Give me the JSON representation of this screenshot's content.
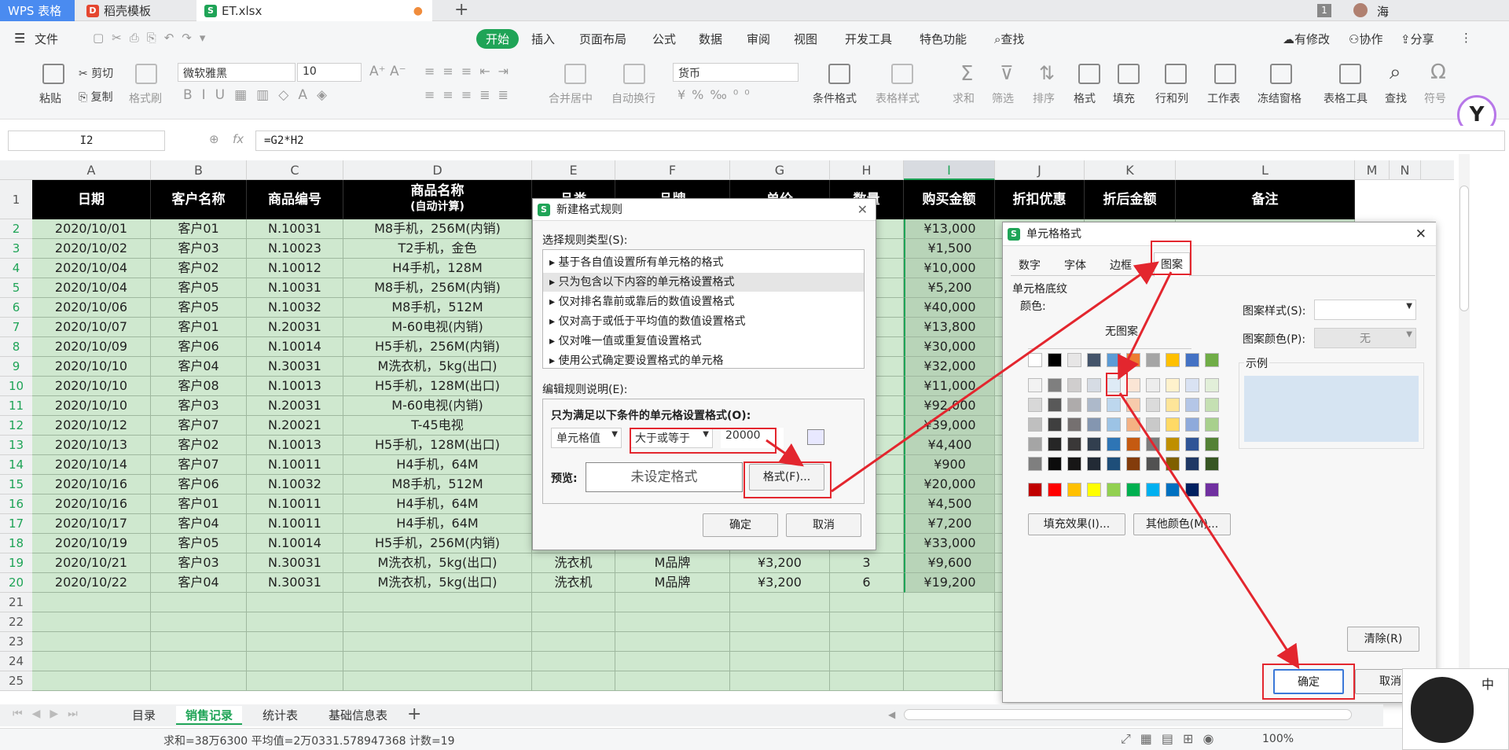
{
  "tabs": {
    "wps": "WPS 表格",
    "daoke": "稻壳模板",
    "file": "ET.xlsx",
    "user": "海",
    "page_count": "1"
  },
  "menu": {
    "file": "文件",
    "items": [
      "开始",
      "插入",
      "页面布局",
      "公式",
      "数据",
      "审阅",
      "视图",
      "开发工具",
      "特色功能"
    ],
    "search": "查找",
    "modified": "有修改",
    "collab": "协作",
    "share": "分享"
  },
  "ribbon": {
    "paste": "粘贴",
    "cut": "剪切",
    "copy": "复制",
    "format_painter": "格式刷",
    "font": "微软雅黑",
    "size": "10",
    "number_format": "货币",
    "merge": "合并居中",
    "wrap": "自动换行",
    "cond_format": "条件格式",
    "table_style": "表格样式",
    "sum": "求和",
    "filter": "筛选",
    "sort": "排序",
    "format": "格式",
    "fill": "填充",
    "rowcol": "行和列",
    "worksheet": "工作表",
    "freeze": "冻结窗格",
    "table_tools": "表格工具",
    "find": "查找",
    "symbol": "符号"
  },
  "formula": {
    "cell": "I2",
    "fx": "fx",
    "value": "=G2*H2"
  },
  "columns": [
    "A",
    "B",
    "C",
    "D",
    "E",
    "F",
    "G",
    "H",
    "I",
    "J",
    "K",
    "L",
    "M",
    "N"
  ],
  "headers": {
    "date": "日期",
    "customer": "客户名称",
    "code": "商品编号",
    "product": "商品名称",
    "product_sub": "(自动计算)",
    "category": "品类",
    "brand": "品牌",
    "price": "单价",
    "qty": "数量",
    "amount": "购买金额",
    "discount": "折扣优惠",
    "after": "折后金额",
    "note": "备注"
  },
  "rows": [
    [
      "2020/10/01",
      "客户01",
      "N.10031",
      "M8手机，256M(内销)",
      "¥13,000"
    ],
    [
      "2020/10/02",
      "客户03",
      "N.10023",
      "T2手机，金色",
      "¥1,500"
    ],
    [
      "2020/10/04",
      "客户02",
      "N.10012",
      "H4手机，128M",
      "¥10,000"
    ],
    [
      "2020/10/04",
      "客户05",
      "N.10031",
      "M8手机，256M(内销)",
      "¥5,200"
    ],
    [
      "2020/10/06",
      "客户05",
      "N.10032",
      "M8手机，512M",
      "¥40,000"
    ],
    [
      "2020/10/07",
      "客户01",
      "N.20031",
      "M-60电视(内销)",
      "¥13,800"
    ],
    [
      "2020/10/09",
      "客户06",
      "N.10014",
      "H5手机，256M(内销)",
      "¥30,000"
    ],
    [
      "2020/10/10",
      "客户04",
      "N.30031",
      "M洗衣机，5kg(出口)",
      "¥32,000"
    ],
    [
      "2020/10/10",
      "客户08",
      "N.10013",
      "H5手机，128M(出口)",
      "¥11,000"
    ],
    [
      "2020/10/10",
      "客户03",
      "N.20031",
      "M-60电视(内销)",
      "¥92,000"
    ],
    [
      "2020/10/12",
      "客户07",
      "N.20021",
      "T-45电视",
      "¥39,000"
    ],
    [
      "2020/10/13",
      "客户02",
      "N.10013",
      "H5手机，128M(出口)",
      "¥4,400"
    ],
    [
      "2020/10/14",
      "客户07",
      "N.10011",
      "H4手机，64M",
      "¥900"
    ],
    [
      "2020/10/16",
      "客户06",
      "N.10032",
      "M8手机，512M",
      "¥20,000"
    ],
    [
      "2020/10/16",
      "客户01",
      "N.10011",
      "H4手机，64M",
      "¥4,500"
    ],
    [
      "2020/10/17",
      "客户04",
      "N.10011",
      "H4手机，64M",
      "¥7,200"
    ],
    [
      "2020/10/19",
      "客户05",
      "N.10014",
      "H5手机，256M(内销)",
      "¥33,000"
    ],
    [
      "2020/10/21",
      "客户03",
      "N.30031",
      "M洗衣机，5kg(出口)",
      "¥9,600"
    ],
    [
      "2020/10/22",
      "客户04",
      "N.30031",
      "M洗衣机，5kg(出口)",
      "¥19,200"
    ]
  ],
  "row19_extra": [
    "洗衣机",
    "M品牌",
    "¥3,200",
    "3"
  ],
  "row20_extra": [
    "洗衣机",
    "M品牌",
    "¥3,200",
    "6"
  ],
  "rule_dialog": {
    "title": "新建格式规则",
    "select_type": "选择规则类型(S):",
    "types": [
      "基于各自值设置所有单元格的格式",
      "只为包含以下内容的单元格设置格式",
      "仅对排名靠前或靠后的数值设置格式",
      "仅对高于或低于平均值的数值设置格式",
      "仅对唯一值或重复值设置格式",
      "使用公式确定要设置格式的单元格"
    ],
    "edit_desc": "编辑规则说明(E):",
    "condition_label": "只为满足以下条件的单元格设置格式(O):",
    "cell_value": "单元格值",
    "operator": "大于或等于",
    "value": "20000",
    "preview_label": "预览:",
    "preview_text": "未设定格式",
    "format_btn": "格式(F)...",
    "ok": "确定",
    "cancel": "取消"
  },
  "cell_dialog": {
    "title": "单元格格式",
    "tabs": [
      "数字",
      "字体",
      "边框",
      "图案"
    ],
    "shading": "单元格底纹",
    "color": "颜色:",
    "no_pattern": "无图案",
    "pattern_style": "图案样式(S):",
    "pattern_color": "图案颜色(P):",
    "pattern_color_value": "无",
    "sample": "示例",
    "fill_effects": "填充效果(I)...",
    "other_colors": "其他颜色(M)...",
    "clear": "清除(R)",
    "ok": "确定",
    "cancel": "取消"
  },
  "sheets": [
    "目录",
    "销售记录",
    "统计表",
    "基础信息表"
  ],
  "status": {
    "summary": "求和=38万6300  平均值=2万0331.578947368  计数=19",
    "zoom": "100%"
  },
  "ime": {
    "lang": "中"
  }
}
